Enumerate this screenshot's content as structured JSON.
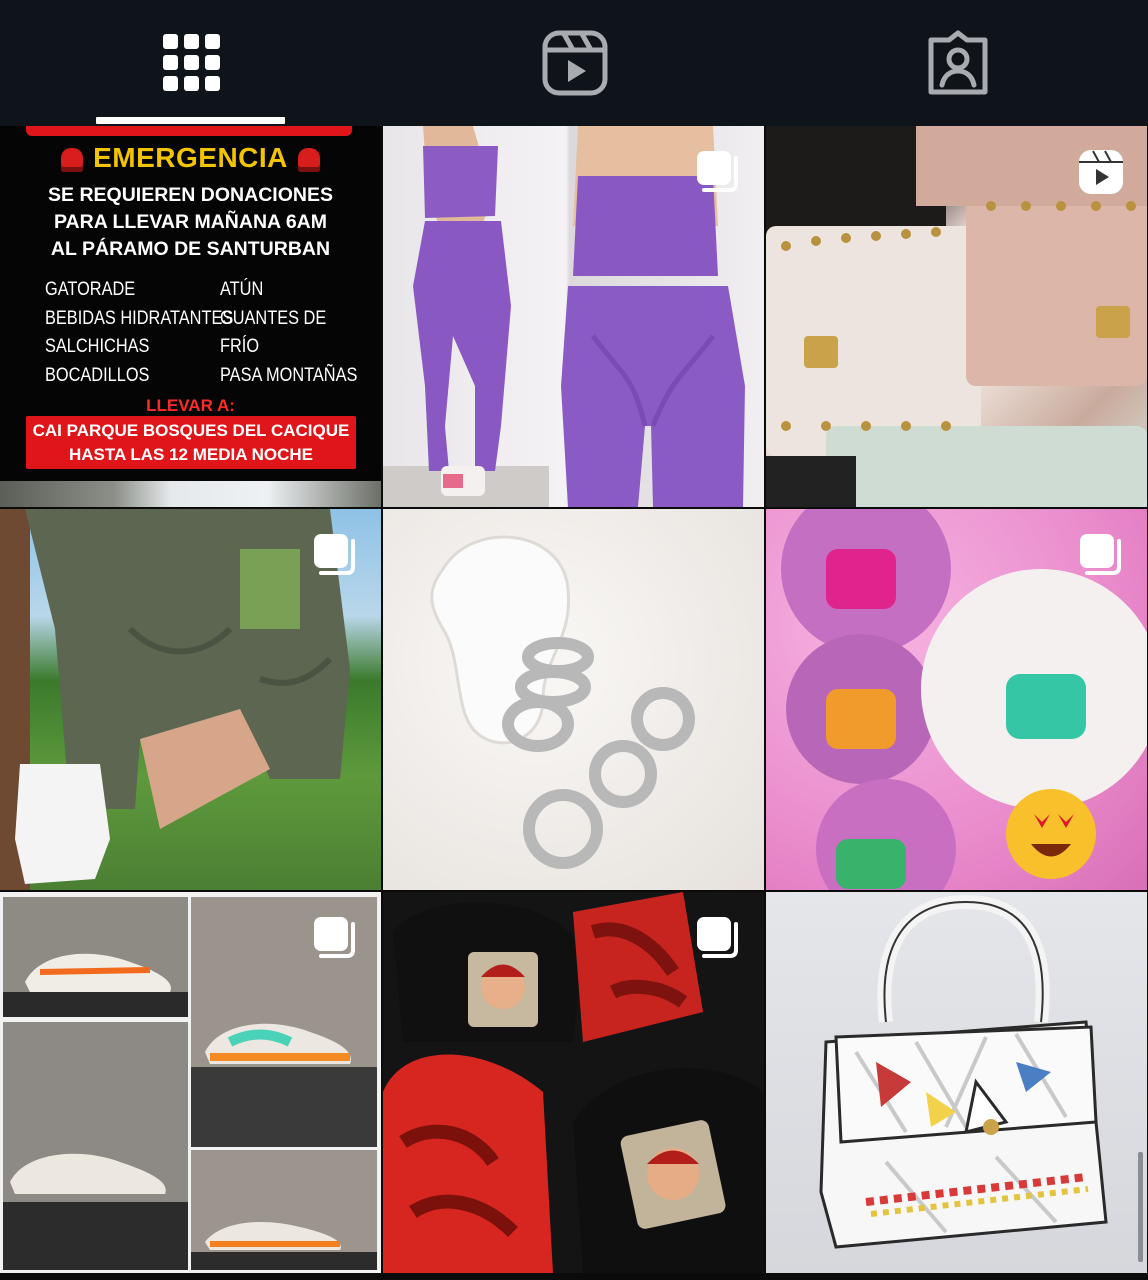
{
  "tabs": [
    {
      "name": "grid",
      "icon": "grid-icon",
      "active": true
    },
    {
      "name": "reels",
      "icon": "reels-icon",
      "active": false
    },
    {
      "name": "tagged",
      "icon": "tagged-icon",
      "active": false
    }
  ],
  "posts": {
    "post1": {
      "heading": "EMERGENCIA",
      "sub1": "SE REQUIEREN DONACIONES",
      "sub2": "PARA LLEVAR MAÑANA 6AM",
      "sub3": "AL PÁRAMO DE SANTURBAN",
      "items_left": [
        "GATORADE",
        "BEBIDAS HIDRATANTES",
        "SALCHICHAS",
        "BOCADILLOS"
      ],
      "items_right": [
        "ATÚN",
        "GUANTES DE FRÍO",
        "PASA MONTAÑAS"
      ],
      "bring_label": "LLEVAR A:",
      "place1": "CAI PARQUE BOSQUES DEL CACIQUE",
      "place2": "HASTA LAS 12 MEDIA NOCHE"
    },
    "overlays": {
      "post2": "carousel-icon",
      "post3": "reel-icon",
      "post4": "carousel-icon",
      "post6": "carousel-icon",
      "post7": "carousel-icon",
      "post8": "carousel-icon"
    }
  },
  "colors": {
    "background": "#0d1117",
    "active_indicator": "#ffffff",
    "inactive_icon": "#a8acb1",
    "poster_yellow": "#f2c400",
    "poster_red": "#e0151a"
  }
}
